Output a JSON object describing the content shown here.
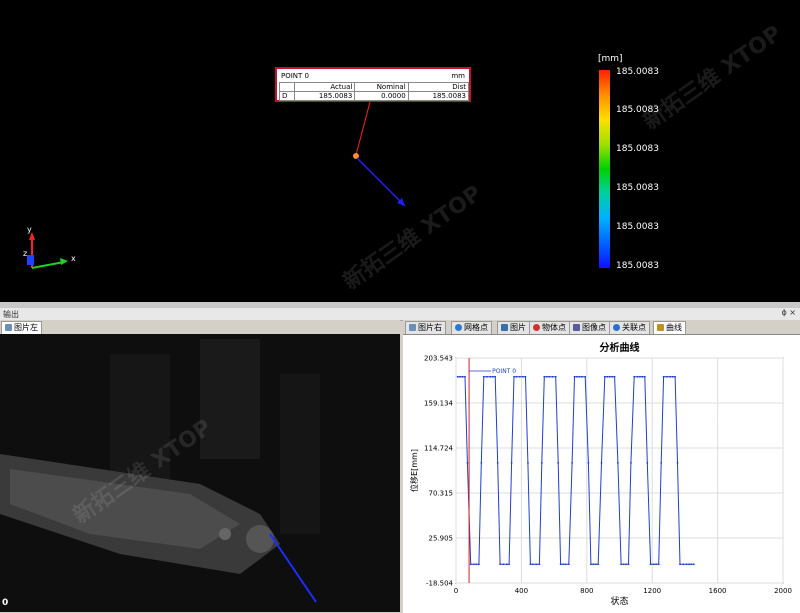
{
  "view3d": {
    "callout": {
      "point": "POINT 0",
      "unit": "mm",
      "columns": [
        "Actual",
        "Nominal",
        "Dist"
      ],
      "row": {
        "label": "D",
        "actual": "185.0083",
        "nominal": "0.0000",
        "dist": "185.0083"
      }
    },
    "colorbar": {
      "unit": "[mm]",
      "labels": [
        "185.0083",
        "185.0083",
        "185.0083",
        "185.0083",
        "185.0083",
        "185.0083"
      ]
    },
    "axes": {
      "y": "y",
      "z": "z",
      "x": "x"
    },
    "watermark": {
      "cn": "新拓三维",
      "en": "XTOP"
    }
  },
  "output_bar": {
    "title": "输出",
    "controls": "ϕ ×"
  },
  "left_panel": {
    "tab": "图片左",
    "corner_label": "0"
  },
  "right_panel": {
    "tabs": [
      "图片右",
      "网格点",
      "图片",
      "物体点",
      "图像点",
      "关联点",
      "曲线"
    ],
    "active_tab": "曲线"
  },
  "colors": {
    "curve": "#1f3fcf",
    "marker": "#e02020",
    "callout_border": "#c8102e"
  },
  "chart_data": {
    "type": "line",
    "title": "分析曲线",
    "xlabel": "状态",
    "ylabel": "位移E[mm]",
    "xlim": [
      0,
      2000
    ],
    "ylim": [
      -18.504,
      203.543
    ],
    "xticks": [
      0,
      400,
      800,
      1200,
      1600,
      2000
    ],
    "yticks": [
      "-18.504",
      "25.905",
      "70.315",
      "114.724",
      "159.134",
      "203.543"
    ],
    "ytick_values": [
      -18.504,
      25.905,
      70.315,
      114.724,
      159.134,
      203.543
    ],
    "marker_x": 80,
    "marker_label": "POINT 0",
    "grid": true,
    "series": [
      {
        "x": [
          10,
          25,
          40,
          55,
          70,
          90,
          110,
          125,
          140,
          155,
          170,
          190,
          210,
          225,
          240,
          255,
          270,
          290,
          310,
          325,
          340,
          355,
          370,
          390,
          410,
          425,
          440,
          455,
          470,
          490,
          510,
          525,
          540,
          555,
          570,
          590,
          610,
          625,
          640,
          655,
          670,
          690,
          710,
          725,
          740,
          755,
          770,
          790,
          810,
          825,
          840,
          855,
          870,
          890,
          910,
          925,
          940,
          955,
          970,
          990,
          1010,
          1025,
          1040,
          1055,
          1070,
          1090,
          1110,
          1125,
          1140,
          1155,
          1170,
          1190,
          1210,
          1225,
          1240,
          1255,
          1270,
          1290,
          1310,
          1325,
          1340,
          1355,
          1370,
          1390,
          1410,
          1425,
          1440,
          1455
        ],
        "y": [
          185,
          185,
          185,
          185,
          100,
          0,
          0,
          0,
          0,
          100,
          185,
          185,
          185,
          185,
          185,
          100,
          0,
          0,
          0,
          0,
          100,
          185,
          185,
          185,
          185,
          185,
          100,
          0,
          0,
          0,
          0,
          100,
          185,
          185,
          185,
          185,
          185,
          100,
          0,
          0,
          0,
          0,
          100,
          185,
          185,
          185,
          185,
          185,
          100,
          0,
          0,
          0,
          0,
          100,
          185,
          185,
          185,
          185,
          185,
          100,
          0,
          0,
          0,
          0,
          100,
          185,
          185,
          185,
          185,
          185,
          100,
          0,
          0,
          0,
          0,
          100,
          185,
          185,
          185,
          185,
          185,
          100,
          0,
          0,
          0,
          0,
          0,
          0
        ]
      }
    ]
  }
}
